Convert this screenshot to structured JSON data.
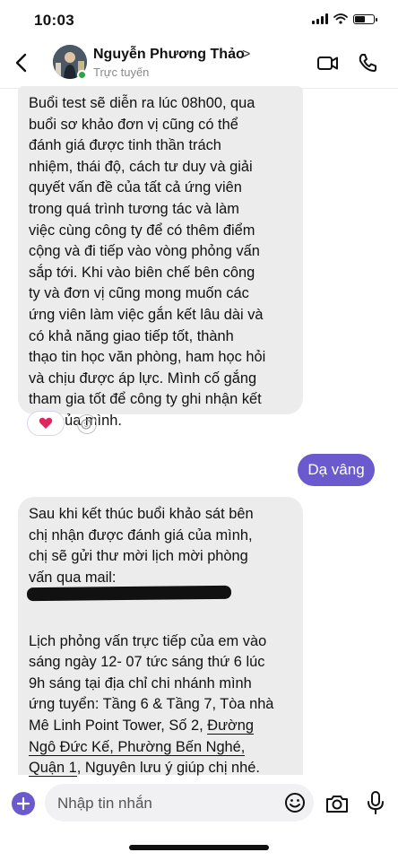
{
  "status_bar": {
    "time": "10:03",
    "battery_level": 0.6
  },
  "header": {
    "contact_name": "Nguyễn Phương Thảo",
    "contact_chevron": ">",
    "contact_status": "Trực tuyến",
    "icons": {
      "back": "chevron-left-icon",
      "video": "video-call-icon",
      "call": "phone-icon"
    }
  },
  "messages": {
    "incoming_1": {
      "lines": [
        "Buổi test sẽ diễn ra lúc 08h00, qua",
        "buổi sơ khảo đơn vị cũng có thể",
        "đánh giá được tinh thần trách",
        "nhiệm, thái độ, cách tư duy và giải",
        "quyết vấn đề của tất cả ứng viên",
        "trong quá trình tương tác và làm",
        "việc cùng công ty để có thêm điểm",
        "cộng và đi tiếp vào vòng phỏng vấn",
        "sắp tới. Khi vào biên chế bên công",
        "ty và đơn vị cũng mong muốn các",
        "ứng viên làm việc gắn kết lâu dài và",
        "có khả năng giao tiếp tốt, thành",
        "thạo tin học văn phòng, ham học hỏi",
        "và chịu được áp lực. Mình cố gắng",
        "tham gia tốt để công ty ghi nhận kết",
        "quả của mình."
      ],
      "reaction": "heart-icon",
      "add_reaction": "add-reaction-icon"
    },
    "outgoing_1": {
      "text": "Dạ vâng"
    },
    "incoming_2": {
      "lines_top": [
        "Sau khi kết thúc buổi khảo sát bên",
        "chị nhận được đánh giá của mình,",
        "chị sẽ gửi thư mời lịch mời phòng",
        "vấn qua mail:"
      ],
      "lines_bottom": [
        "Lịch phỏng vấn trực tiếp của em vào",
        "sáng ngày 12- 07 tức sáng thứ 6 lúc",
        "9h sáng tại địa chỉ chi nhánh mình",
        "ứng tuyển: Tầng 6 & Tầng 7, Tòa nhà"
      ],
      "addr_line_1a": "Mê Linh Point Tower, Số 2, ",
      "addr_line_1b": "Đường",
      "addr_line_2a": "Ngô Đức Kế, Phường Bến Nghé,",
      "addr_line_3a": "Quận 1",
      "addr_line_3b": ", Nguyên lưu ý giúp chị nhé."
    }
  },
  "composer": {
    "placeholder": "Nhập tin nhắn",
    "icons": {
      "plus": "plus-icon",
      "emoji": "emoji-icon",
      "camera": "camera-icon",
      "mic": "microphone-icon"
    }
  },
  "colors": {
    "accent": "#6a5acd",
    "bubble_incoming": "#ececec",
    "online": "#31a24c",
    "heart": "#e0245e"
  }
}
